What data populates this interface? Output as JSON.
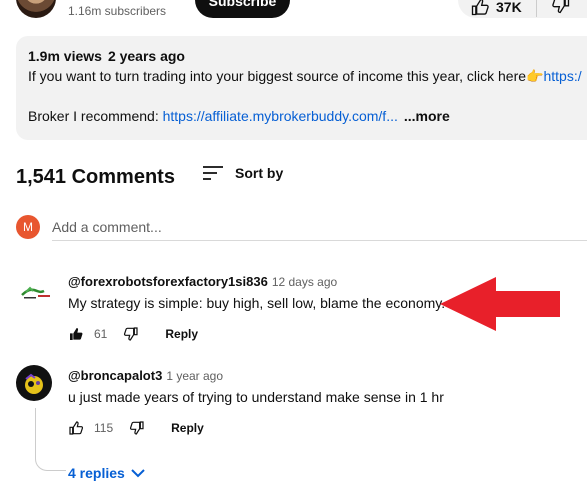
{
  "channel": {
    "subscribers": "1.16m subscribers",
    "subscribe_label": "Subscribe"
  },
  "actions": {
    "likes": "37K"
  },
  "description": {
    "views": "1.9m views",
    "age": "2 years ago",
    "line1_text": "If you want to turn trading into your biggest source of income this year, click here",
    "line1_emoji": "👉",
    "line1_link": "https:/",
    "line2_label": "Broker I recommend: ",
    "line2_link": "https://affiliate.mybrokerbuddy.com/f...",
    "more_label": "...more"
  },
  "comments_header": {
    "count": "1,541 Comments",
    "sort_label": "Sort by"
  },
  "add_comment": {
    "avatar_letter": "M",
    "placeholder": "Add a comment..."
  },
  "comments": [
    {
      "author": "@forexrobotsforexfactory1si836",
      "time": "12 days ago",
      "text": "My strategy is simple: buy high, sell low, blame the economy.",
      "likes": "61",
      "reply_label": "Reply",
      "liked": true
    },
    {
      "author": "@broncapalot3",
      "time": "1 year ago",
      "text": "u just made years of trying to understand make sense in 1 hr",
      "likes": "115",
      "reply_label": "Reply",
      "liked": false,
      "replies_label": "4 replies"
    }
  ],
  "colors": {
    "accent_link": "#065fd4",
    "annotation_arrow": "#e8202a",
    "my_avatar": "#e8562f"
  },
  "icons": [
    "thumbs-up-icon",
    "thumbs-down-icon",
    "sort-icon",
    "chevron-down-icon",
    "pointing-hand-icon",
    "red-arrow-annotation"
  ]
}
